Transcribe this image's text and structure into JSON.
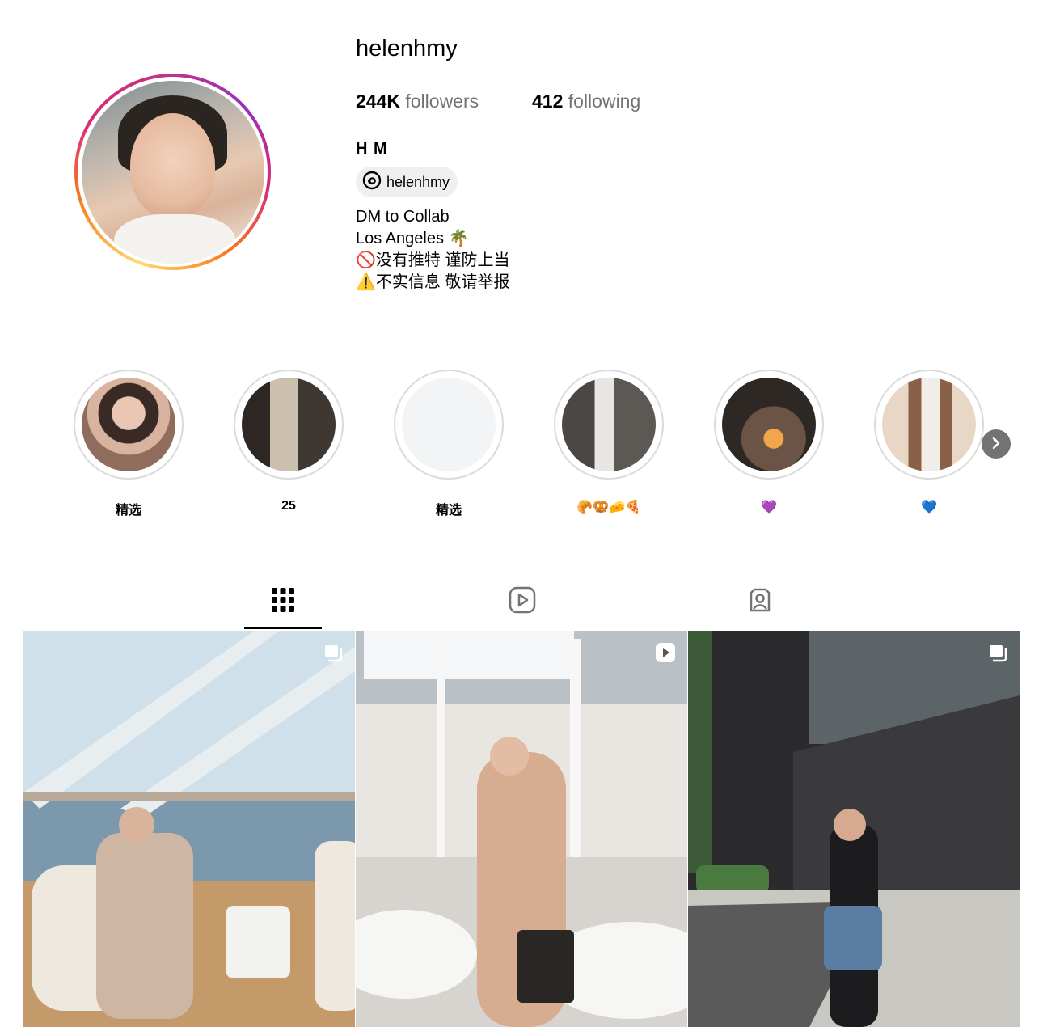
{
  "profile": {
    "username": "helenhmy",
    "followers_count": "244K",
    "followers_label": "followers",
    "following_count": "412",
    "following_label": "following",
    "full_name": "H M",
    "threads_handle": "helenhmy",
    "bio": [
      "DM to Collab",
      "Los Angeles 🌴",
      "🚫没有推特 谨防上当",
      "⚠️不实信息 敬请举报"
    ]
  },
  "highlights": [
    {
      "label": "精选"
    },
    {
      "label": "25"
    },
    {
      "label": "精选"
    },
    {
      "label": "🥐🥨🧀🍕"
    },
    {
      "label": "💜"
    },
    {
      "label": "💙"
    }
  ],
  "tabs": [
    {
      "name": "posts",
      "icon": "grid-icon",
      "active": true
    },
    {
      "name": "reels",
      "icon": "reels-icon",
      "active": false
    },
    {
      "name": "tagged",
      "icon": "tagged-icon",
      "active": false
    }
  ],
  "posts": [
    {
      "badge": "carousel-icon"
    },
    {
      "badge": "reel-icon"
    },
    {
      "badge": "carousel-icon"
    }
  ],
  "colors": {
    "muted_text": "#737373",
    "pill_bg": "#efefef",
    "highlight_ring": "#dbdbdb"
  }
}
